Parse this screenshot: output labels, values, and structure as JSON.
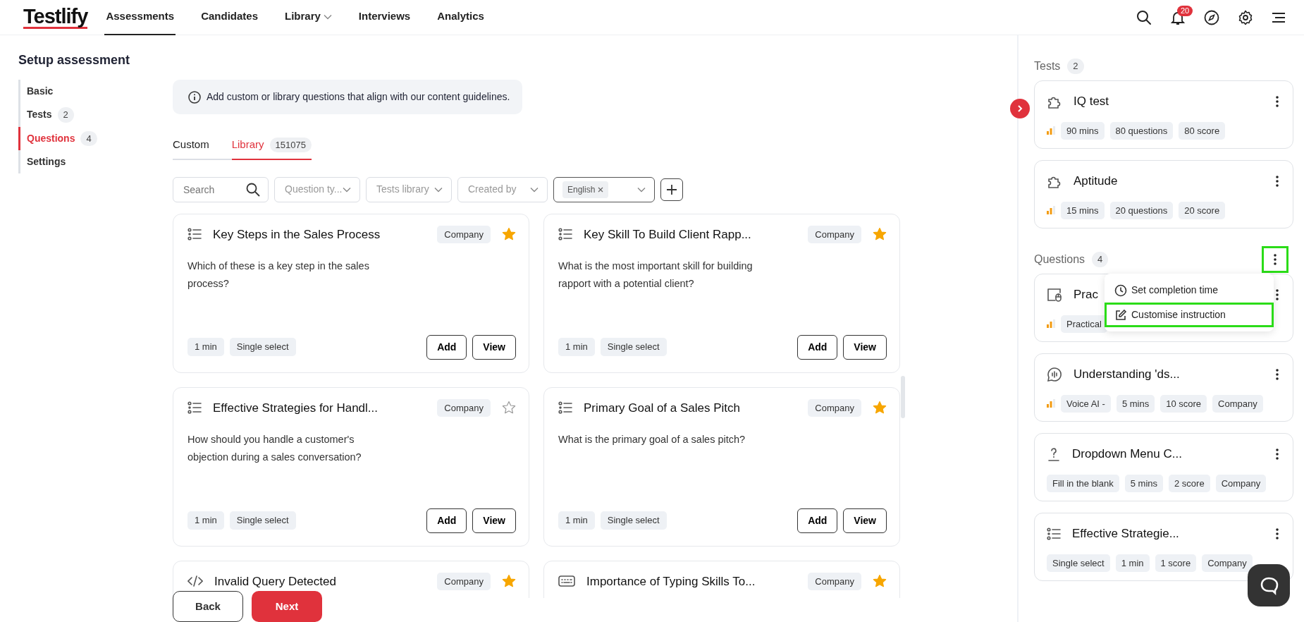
{
  "nav": {
    "logo": "Testlify",
    "links": [
      {
        "label": "Assessments",
        "selected": true,
        "dropdown": false
      },
      {
        "label": "Candidates",
        "selected": false,
        "dropdown": false
      },
      {
        "label": "Library",
        "selected": false,
        "dropdown": true
      },
      {
        "label": "Interviews",
        "selected": false,
        "dropdown": false
      },
      {
        "label": "Analytics",
        "selected": false,
        "dropdown": false
      }
    ],
    "notification_count": "20"
  },
  "sidebar": {
    "title": "Setup assessment",
    "items": [
      {
        "label": "Basic",
        "selected": false
      },
      {
        "label": "Tests",
        "count": "2",
        "selected": false
      },
      {
        "label": "Questions",
        "count": "4",
        "selected": true
      },
      {
        "label": "Settings",
        "selected": false
      }
    ]
  },
  "info": "Add custom or library questions that align with our content guidelines.",
  "tabs": [
    {
      "label": "Custom",
      "selected": false
    },
    {
      "label": "Library",
      "count": "151075",
      "selected": true
    }
  ],
  "filters": {
    "search": {
      "placeholder": "Search"
    },
    "selects": [
      {
        "placeholder": "Question ty..."
      },
      {
        "placeholder": "Tests library"
      },
      {
        "placeholder": "Created by"
      }
    ],
    "language": {
      "chips": [
        "English"
      ]
    }
  },
  "questions": [
    {
      "kind": "list",
      "title": "Key Steps in the Sales Process",
      "tag": "Company",
      "starred": true,
      "text": "Which of these is a key step in the sales process?",
      "meta": [
        "1 min",
        "Single select"
      ],
      "actions": [
        "Add",
        "View"
      ]
    },
    {
      "kind": "list",
      "title": "Key Skill To Build Client Rapp...",
      "tag": "Company",
      "starred": true,
      "text": "What is the most important skill for building rapport with a potential client?",
      "meta": [
        "1 min",
        "Single select"
      ],
      "actions": [
        "Add",
        "View"
      ]
    },
    {
      "kind": "list",
      "title": "Effective Strategies for Handl...",
      "tag": "Company",
      "starred": false,
      "text": "How should you handle a customer's objection during a sales conversation?",
      "meta": [
        "1 min",
        "Single select"
      ],
      "actions": [
        "Add",
        "View"
      ]
    },
    {
      "kind": "list",
      "title": "Primary Goal of a Sales Pitch",
      "tag": "Company",
      "starred": true,
      "text": "What is the primary goal of a sales pitch?",
      "meta": [
        "1 min",
        "Single select"
      ],
      "actions": [
        "Add",
        "View"
      ]
    },
    {
      "kind": "code",
      "title": "Invalid Query Detected",
      "tag": "Company",
      "starred": true
    },
    {
      "kind": "keyboard",
      "title": "Importance of Typing Skills To...",
      "tag": "Company",
      "starred": true
    }
  ],
  "footer": {
    "buttons": [
      {
        "label": "Back",
        "kind": "outline"
      },
      {
        "label": "Next",
        "kind": "primary"
      }
    ]
  },
  "panel": {
    "tests": {
      "title": "Tests",
      "count": "2",
      "items": [
        {
          "kind": "puzzle",
          "title": "IQ test",
          "show_difficulty": true,
          "tags": [
            "90 mins",
            "80 questions",
            "80 score"
          ]
        },
        {
          "kind": "puzzle",
          "title": "Aptitude",
          "show_difficulty": true,
          "tags": [
            "15 mins",
            "20 questions",
            "20 score"
          ]
        }
      ]
    },
    "questions": {
      "title": "Questions",
      "count": "4",
      "menu_highlighted": true,
      "items": [
        {
          "kind": "practical",
          "title": "Prac",
          "show_difficulty": true,
          "tags": [
            "Practical"
          ]
        },
        {
          "kind": "voice",
          "title": "Understanding 'ds...",
          "show_difficulty": true,
          "tags": [
            "Voice AI -",
            "5 mins",
            "10 score",
            "Company"
          ]
        },
        {
          "kind": "blank",
          "title": "Dropdown Menu C...",
          "show_difficulty": false,
          "tags": [
            "Fill in the blank",
            "5 mins",
            "2 score",
            "Company"
          ]
        },
        {
          "kind": "list",
          "title": "Effective Strategie...",
          "show_difficulty": false,
          "tags": [
            "Single select",
            "1 min",
            "1 score",
            "Company"
          ]
        }
      ]
    },
    "menu": [
      {
        "label": "Set completion time",
        "kind": "clock",
        "highlighted": false
      },
      {
        "label": "Customise instruction",
        "kind": "edit",
        "highlighted": true
      }
    ]
  }
}
